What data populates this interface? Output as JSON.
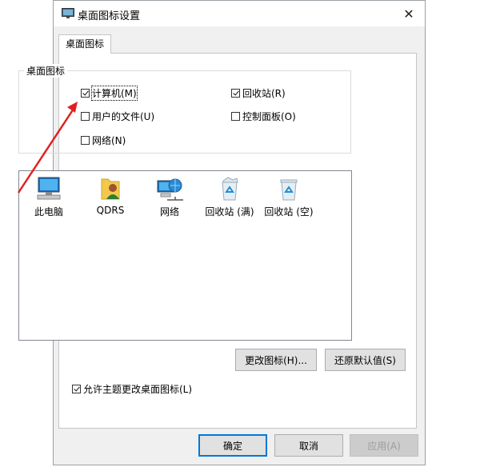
{
  "dialog": {
    "title": "桌面图标设置",
    "close_glyph": "✕"
  },
  "tab": {
    "label": "桌面图标"
  },
  "group": {
    "legend": "桌面图标",
    "checkboxes": [
      {
        "label": "计算机(M)",
        "checked": true
      },
      {
        "label": "回收站(R)",
        "checked": true
      },
      {
        "label": "用户的文件(U)",
        "checked": false
      },
      {
        "label": "控制面板(O)",
        "checked": false
      },
      {
        "label": "网络(N)",
        "checked": false
      }
    ]
  },
  "icons": [
    {
      "label": "此电脑",
      "icon": "computer-icon"
    },
    {
      "label": "QDRS",
      "icon": "user-folder-icon"
    },
    {
      "label": "网络",
      "icon": "network-icon"
    },
    {
      "label": "回收站 (满)",
      "icon": "recycle-bin-full-icon"
    },
    {
      "label": "回收站 (空)",
      "icon": "recycle-bin-empty-icon"
    }
  ],
  "buttons": {
    "change_icon": "更改图标(H)...",
    "restore_default": "还原默认值(S)",
    "ok": "确定",
    "cancel": "取消",
    "apply": "应用(A)"
  },
  "allow_themes": {
    "label": "允许主题更改桌面图标(L)",
    "checked": true
  },
  "colors": {
    "annotation_arrow": "#e02020",
    "accent": "#0078d7"
  }
}
